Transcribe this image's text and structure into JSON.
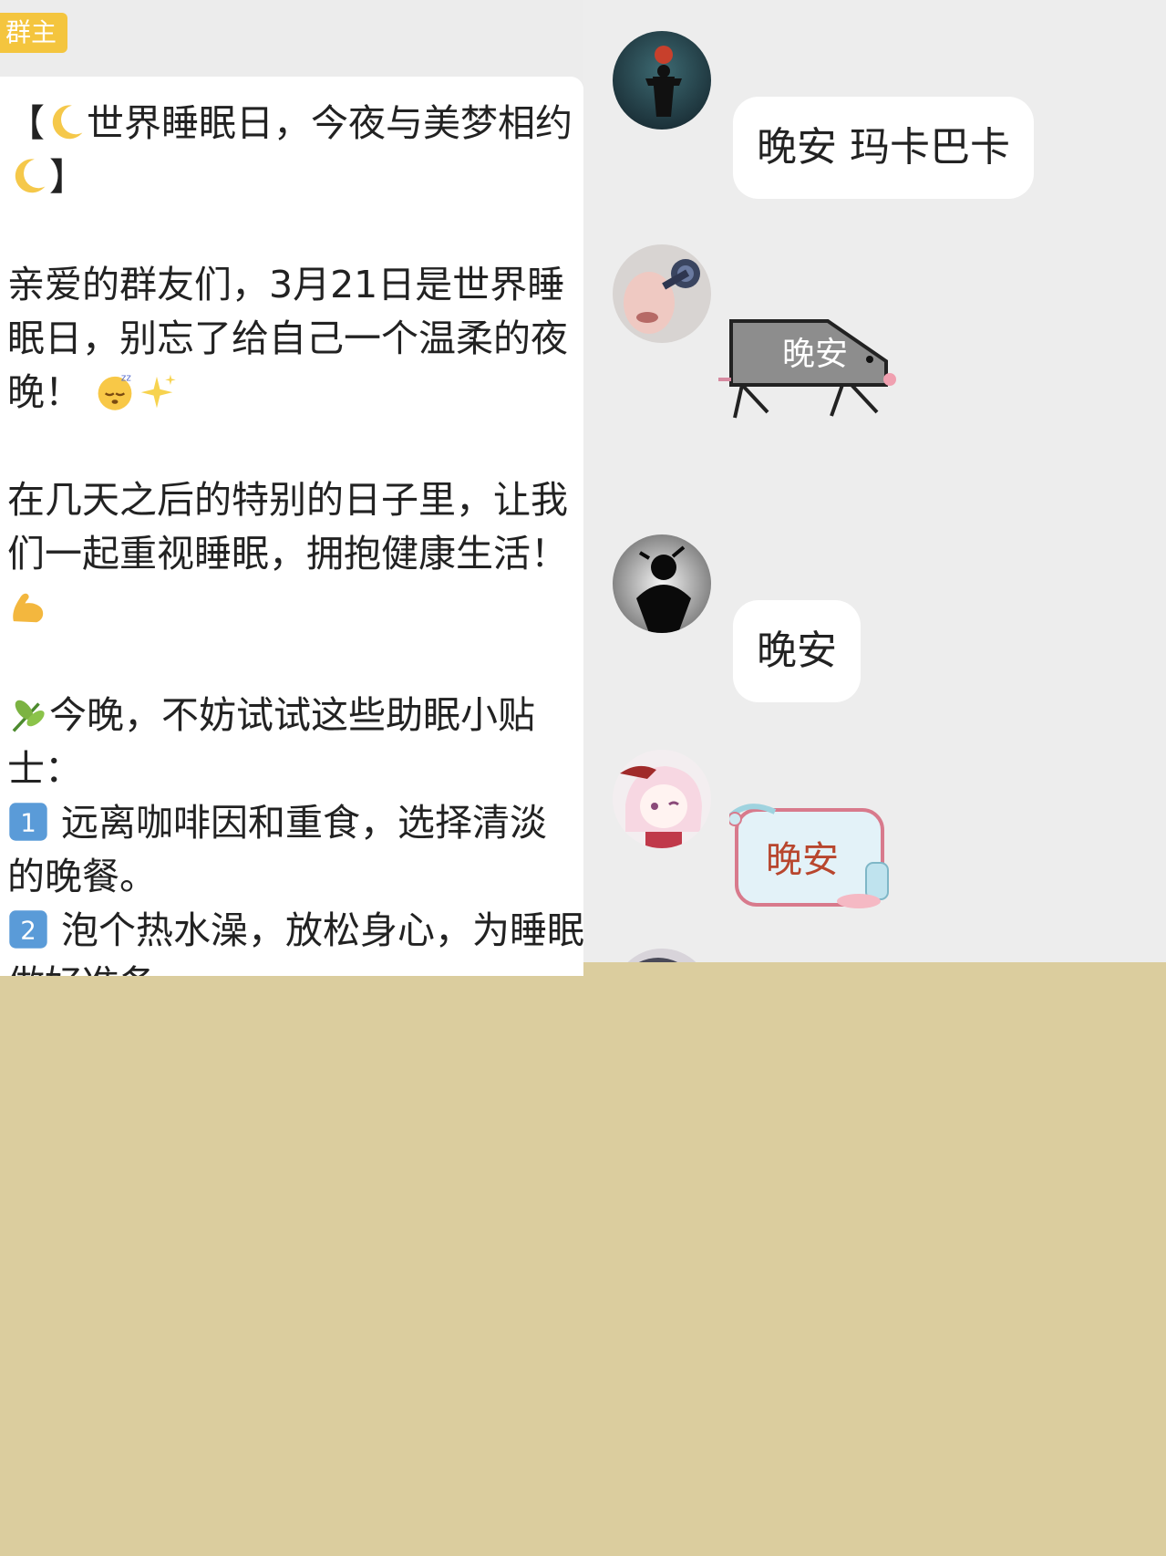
{
  "left": {
    "badge": "群主",
    "announcement": {
      "line1": "【",
      "line1_text": "世界睡眠日，今夜与美梦相约",
      "line2_end": "】",
      "p1_a": "亲爱的群友们，3月21日是世界睡",
      "p1_b": "眠日，别忘了给自己一个温柔的夜",
      "p1_c": "晚！",
      "p2_a": "在几天之后的特别的日子里，让我",
      "p2_b": "们一起重视睡眠，拥抱健康生活！",
      "p3_a": "今晚，不妨试试这些助眠小贴",
      "p3_b": "士：",
      "tip1_num": "1",
      "tip1_a": " 远离咖啡因和重食，选择清淡",
      "tip1_b": "的晚餐。",
      "tip2_num": "2",
      "tip2_a": " 泡个热水澡，放松身心，为睡眠",
      "tip2_b": "做好准备。"
    }
  },
  "right": {
    "messages": [
      {
        "type": "text",
        "text": "晚安 玛卡巴卡"
      },
      {
        "type": "sticker",
        "text": "晚安",
        "style": "gray-mouse"
      },
      {
        "type": "text",
        "text": "晚安"
      },
      {
        "type": "sticker",
        "text": "晚安",
        "style": "pink-frame"
      }
    ]
  },
  "colors": {
    "badge": "#f4c53e",
    "bottom_fill": "#dbcd9e",
    "chat_bg": "#ededed",
    "sticker_red": "#b8462e"
  }
}
